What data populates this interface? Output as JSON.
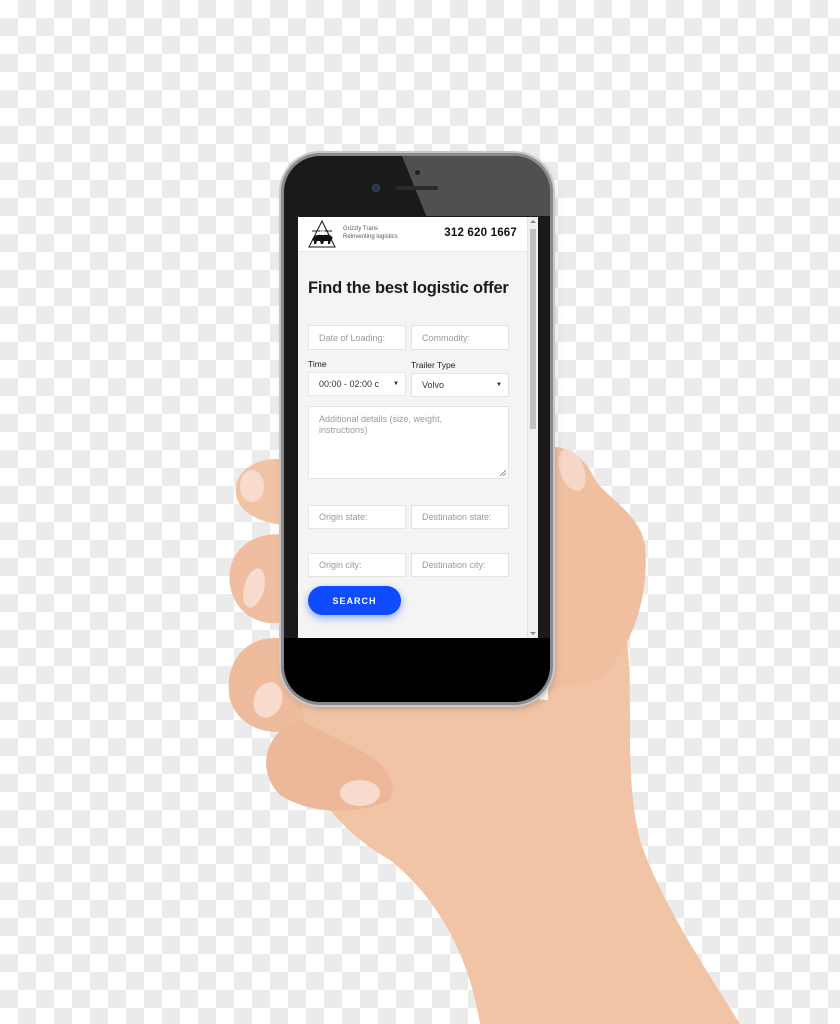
{
  "site": {
    "brand_name": "Grizzly Trans",
    "tagline": "Reinventing logistics",
    "logo_text": "GRIZZLY TRANS",
    "phone_number": "312 620 1667"
  },
  "form": {
    "title": "Find the best logistic offer",
    "date_of_loading_placeholder": "Date of Loading:",
    "commodity_placeholder": "Commodity:",
    "time_label": "Time",
    "time_value": "00:00 - 02:00 c",
    "trailer_type_label": "Trailer Type",
    "trailer_type_value": "Volvo",
    "additional_details_placeholder": "Additional details (size, weight, instructions)",
    "origin_state_placeholder": "Origin state:",
    "destination_state_placeholder": "Destination state:",
    "origin_city_placeholder": "Origin city:",
    "destination_city_placeholder": "Destination city:",
    "search_label": "SEARCH"
  },
  "icons": {
    "dropdown_arrow": "▼"
  },
  "colors": {
    "accent": "#0f4bff",
    "page_background": "#f4f4f4"
  }
}
